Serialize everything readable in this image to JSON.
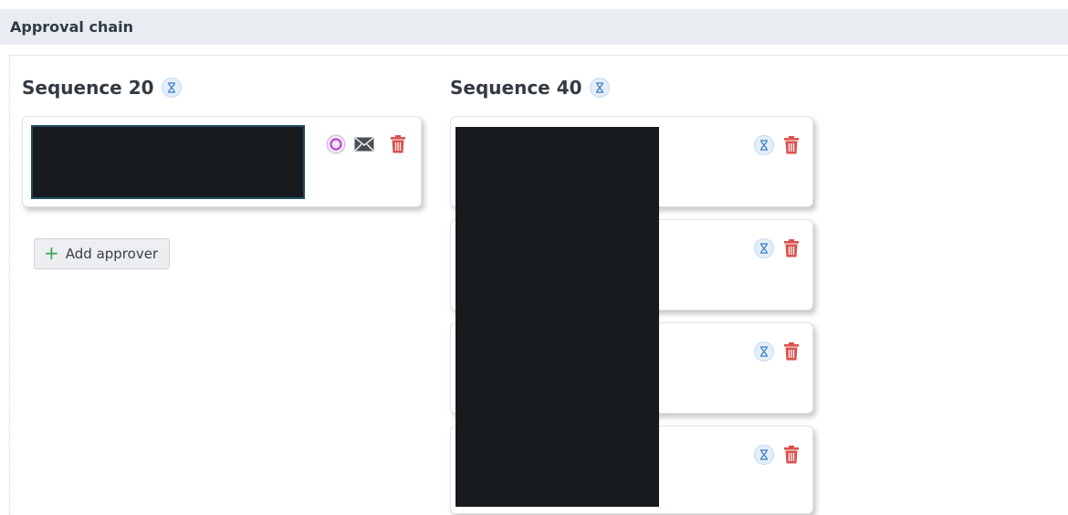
{
  "section": {
    "title": "Approval chain"
  },
  "sequences": [
    {
      "title": "Sequence 20",
      "status_icon": "hourglass-icon"
    },
    {
      "title": "Sequence 40",
      "status_icon": "hourglass-icon"
    }
  ],
  "sequence20": {
    "approver_actions": [
      "in-progress-icon",
      "envelope-icon",
      "trash-icon"
    ],
    "add_button_label": "Add approver"
  },
  "sequence40": {
    "approver_count": 4,
    "approver_actions": [
      "hourglass-icon",
      "trash-icon"
    ]
  },
  "colors": {
    "header_bg": "#e9ecf1",
    "delete_red": "#d9534f",
    "pending_blue": "#3a7ec2",
    "in_progress_purple": "#b04fc5",
    "add_green": "#3fa34d"
  }
}
